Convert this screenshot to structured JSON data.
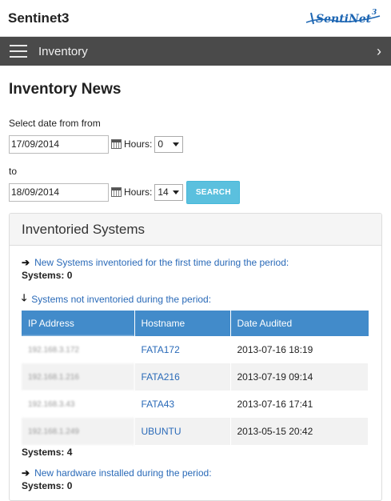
{
  "app": {
    "title": "Sentinet3",
    "logo_text": "SentiNet3"
  },
  "nav": {
    "title": "Inventory"
  },
  "page": {
    "title": "Inventory News",
    "from_label": "Select date from from",
    "from_date": "17/09/2014",
    "from_hours_label": "Hours:",
    "from_hours": "0",
    "to_label": "to",
    "to_date": "18/09/2014",
    "to_hours_label": "Hours:",
    "to_hours": "14",
    "search_label": "SEARCH"
  },
  "panel": {
    "title": "Inventoried Systems",
    "new_systems_link": "New Systems inventoried for the first time during the period:",
    "new_systems_count": "Systems: 0",
    "not_inventoried_link": "Systems not inventoried during the period:",
    "table": {
      "headers": [
        "IP Address",
        "Hostname",
        "Date Audited"
      ],
      "rows": [
        {
          "ip": "192.168.3.172",
          "host": "FATA172",
          "date": "2013-07-16 18:19"
        },
        {
          "ip": "192.168.1.216",
          "host": "FATA216",
          "date": "2013-07-19 09:14"
        },
        {
          "ip": "192.168.3.43",
          "host": "FATA43",
          "date": "2013-07-16 17:41"
        },
        {
          "ip": "192.168.1.249",
          "host": "UBUNTU",
          "date": "2013-05-15 20:42"
        }
      ]
    },
    "not_inventoried_count": "Systems: 4",
    "new_hardware_link": "New hardware installed during the period:",
    "new_hardware_count": "Systems: 0"
  },
  "colors": {
    "navbar": "#4a4a4a",
    "table_header": "#428bca",
    "link": "#2a6ab8",
    "search_button": "#5bc0de"
  }
}
